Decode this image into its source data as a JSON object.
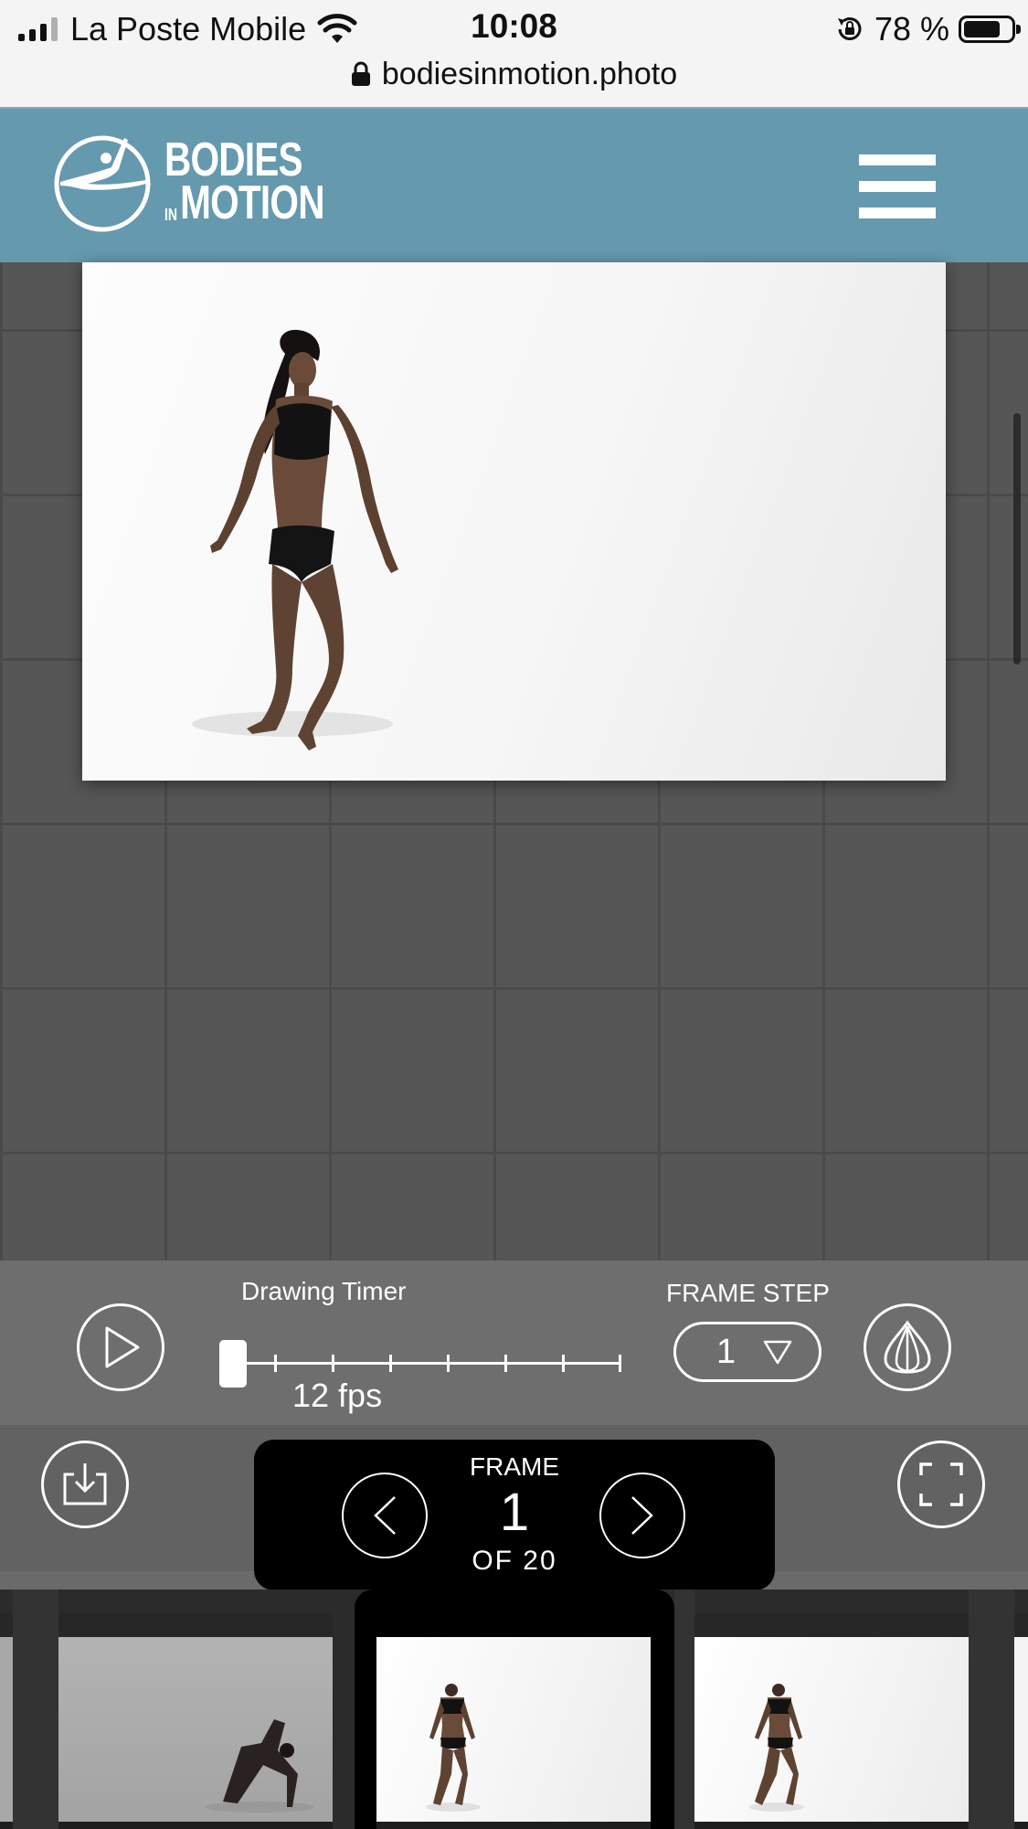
{
  "status_bar": {
    "carrier": "La Poste Mobile",
    "time": "10:08",
    "battery_percent": "78 %",
    "battery_level": 0.78,
    "url": "bodiesinmotion.photo"
  },
  "header": {
    "logo_line1": "BODIES",
    "logo_line2_small": "IN",
    "logo_line2": "MOTION"
  },
  "controls": {
    "drawing_timer_label": "Drawing Timer",
    "fps_label": "12 fps",
    "timer_position": 0,
    "frame_step_label": "FRAME STEP",
    "frame_step_value": "1"
  },
  "frame_nav": {
    "label": "FRAME",
    "current": "1",
    "total_label": "OF 20"
  },
  "colors": {
    "header_bg": "#6599ae",
    "stage_bg": "#565656",
    "controls_bg": "#6e6e6e",
    "accent": "#ffffff"
  }
}
